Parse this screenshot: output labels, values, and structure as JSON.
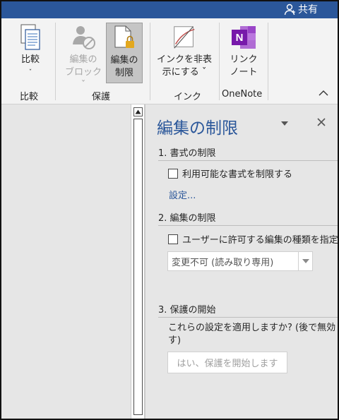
{
  "titlebar": {
    "share_label": "共有"
  },
  "ribbon": {
    "buttons": [
      {
        "label_line1": "比較",
        "label_line2": "ˇ",
        "icon": "compare-icon",
        "state": "normal"
      },
      {
        "label_line1": "編集の",
        "label_line2": "ブロック ˇ",
        "icon": "block-authors-icon",
        "state": "disabled"
      },
      {
        "label_line1": "編集の",
        "label_line2": "制限",
        "icon": "restrict-editing-icon",
        "state": "selected"
      },
      {
        "label_line1": "インクを非表",
        "label_line2": "示にする ˇ",
        "icon": "hide-ink-icon",
        "state": "normal"
      },
      {
        "label_line1": "リンク",
        "label_line2": "ノート",
        "icon": "onenote-icon",
        "state": "normal"
      }
    ],
    "groups": [
      "比較",
      "保護",
      "インク",
      "OneNote"
    ],
    "colors": {
      "onenote": "#7719aa",
      "accent": "#2b579a"
    }
  },
  "pane": {
    "title": "編集の制限",
    "sections": [
      {
        "heading": "1. 書式の制限"
      },
      {
        "heading": "2. 編集の制限"
      },
      {
        "heading": "3. 保護の開始"
      }
    ],
    "format_checkbox_label": "利用可能な書式を制限する",
    "format_checkbox_checked": false,
    "settings_link": "設定...",
    "edit_checkbox_label": "ユーザーに許可する編集の種類を指定",
    "edit_checkbox_checked": false,
    "edit_type_selected": "変更不可 (読み取り専用)",
    "apply_question_line1": "これらの設定を適用しますか? (後で無効",
    "apply_question_line2": "す)",
    "start_button_label": "はい、保護を開始します"
  }
}
